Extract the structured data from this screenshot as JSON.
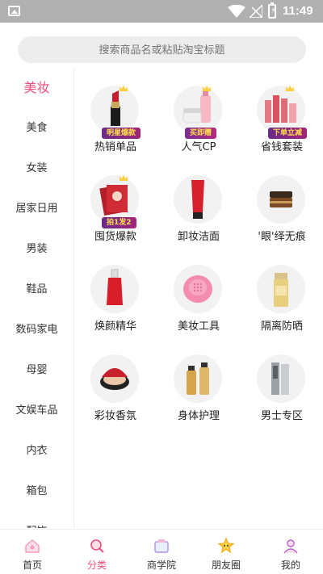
{
  "status": {
    "time": "11:49"
  },
  "search": {
    "placeholder": "搜索商品名或粘贴淘宝标题"
  },
  "sidebar": {
    "items": [
      "美妆",
      "美食",
      "女装",
      "居家日用",
      "男装",
      "鞋品",
      "数码家电",
      "母婴",
      "文娱车品",
      "内衣",
      "箱包",
      "配饰"
    ],
    "active": "美妆"
  },
  "grid": {
    "items": [
      {
        "label": "热销单品",
        "badge": "明星爆款",
        "icon": "lipstick-icon"
      },
      {
        "label": "人气CP",
        "badge": "买即赠",
        "icon": "cream-set-icon"
      },
      {
        "label": "省钱套装",
        "badge": "下单立减",
        "icon": "skincare-set-icon"
      },
      {
        "label": "囤货爆款",
        "badge": "拍1发2",
        "icon": "face-mask-icon"
      },
      {
        "label": "卸妆洁面",
        "badge": "",
        "icon": "cleanser-tube-icon"
      },
      {
        "label": "'眼'绎无痕",
        "badge": "",
        "icon": "eye-cream-icon"
      },
      {
        "label": "焕颜精华",
        "badge": "",
        "icon": "serum-bottle-icon"
      },
      {
        "label": "美妆工具",
        "badge": "",
        "icon": "cleansing-brush-icon"
      },
      {
        "label": "隔离防晒",
        "badge": "",
        "icon": "sunscreen-icon"
      },
      {
        "label": "彩妆香氛",
        "badge": "",
        "icon": "cushion-compact-icon"
      },
      {
        "label": "身体护理",
        "badge": "",
        "icon": "body-care-icon"
      },
      {
        "label": "男士专区",
        "badge": "",
        "icon": "men-skincare-icon"
      }
    ]
  },
  "tabbar": {
    "items": [
      {
        "label": "首页",
        "icon": "home-icon"
      },
      {
        "label": "分类",
        "icon": "category-icon"
      },
      {
        "label": "商学院",
        "icon": "academy-icon"
      },
      {
        "label": "朋友圈",
        "icon": "moments-icon"
      },
      {
        "label": "我的",
        "icon": "profile-icon"
      }
    ],
    "active": "分类"
  },
  "colors": {
    "accent": "#ee4f7c",
    "statusbar": "#b0b0b0",
    "search_bg": "#ededed"
  }
}
